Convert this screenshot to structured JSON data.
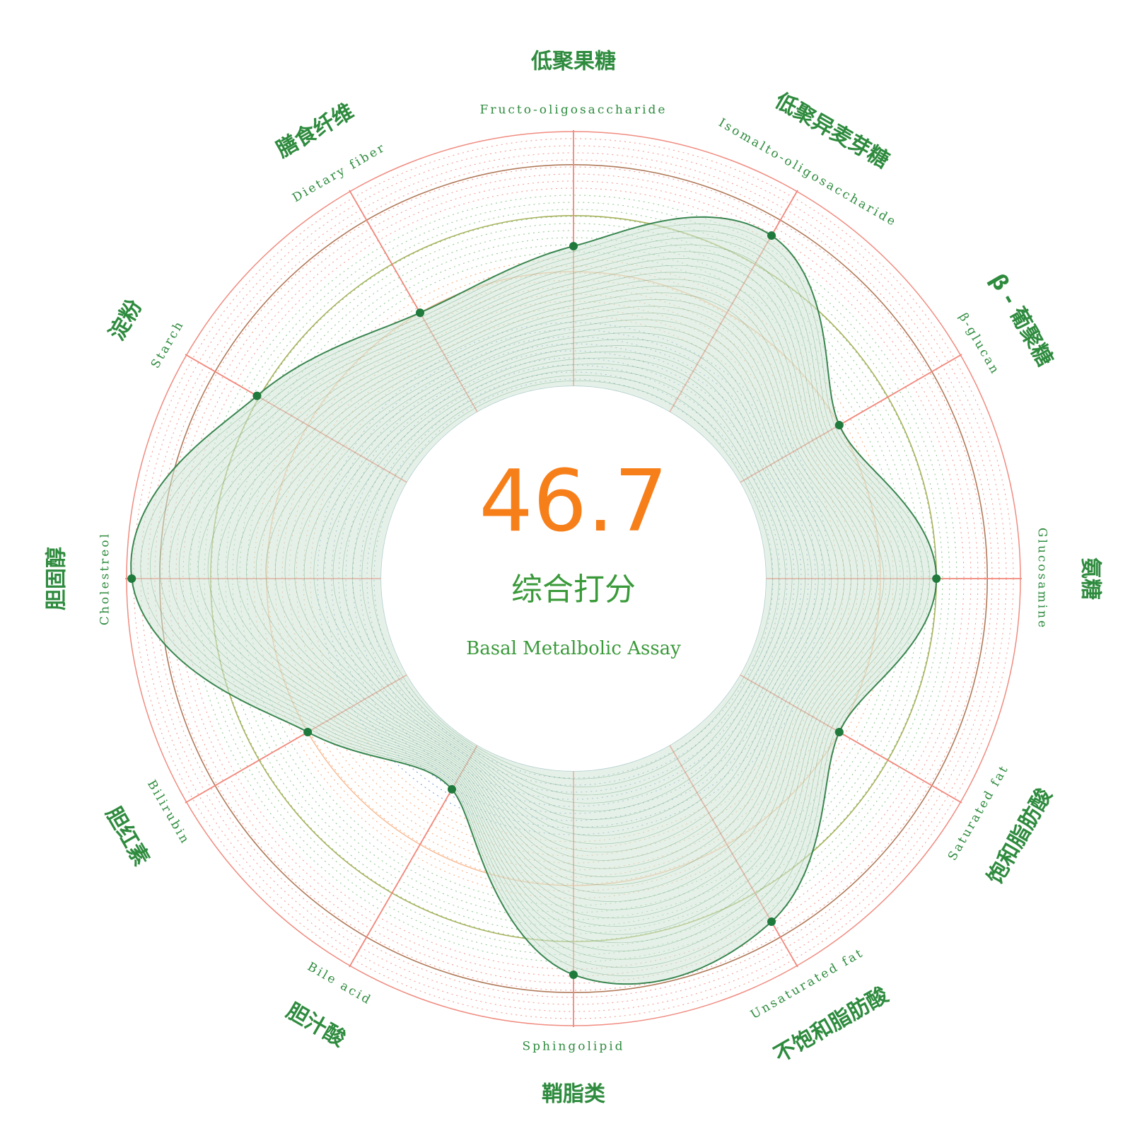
{
  "center": {
    "score": "46.7",
    "title_cn": "综合打分",
    "title_en": "Basal Metalbolic Assay"
  },
  "colors": {
    "score": "#f77f1a",
    "label": "#2e8b3e",
    "curve": "#2f7f48",
    "fill": "#cfe6d6",
    "axis": "#f2867a",
    "ring_red": "#f08c80",
    "ring_green": "#7fbf7f",
    "ring_orange": "#f5a06a",
    "ring_blue": "#6a8fd0",
    "ring_brown": "#b07a5a",
    "ring_olive": "#a8b25c",
    "inner_circle": "#8fb0c8",
    "point": "#1f7a3c"
  },
  "chart_data": {
    "type": "radar",
    "title": "",
    "categories": [
      {
        "cn": "低聚果糖",
        "en": "Fructo-oligosaccharide"
      },
      {
        "cn": "低聚异麦芽糖",
        "en": "Isomalto-oligosaccharide"
      },
      {
        "cn": "β - 葡聚糖",
        "en": "β-glucan"
      },
      {
        "cn": "氨糖",
        "en": "Glucosamine"
      },
      {
        "cn": "饱和脂肪酸",
        "en": "Saturated fat"
      },
      {
        "cn": "不饱和脂肪酸",
        "en": "Unsaturated fat"
      },
      {
        "cn": "鞘脂类",
        "en": "Sphingolipid"
      },
      {
        "cn": "胆汁酸",
        "en": "Bile acid"
      },
      {
        "cn": "胆红素",
        "en": "Bilirubin"
      },
      {
        "cn": "胆固醇",
        "en": "Cholestreol"
      },
      {
        "cn": "淀粉",
        "en": "Starch"
      },
      {
        "cn": "膳食纤维",
        "en": "Dietary fiber"
      }
    ],
    "values": [
      55,
      80,
      45,
      67,
      45,
      80,
      80,
      20,
      45,
      98,
      68,
      45
    ],
    "rlim": [
      0,
      100
    ],
    "grid": true
  }
}
